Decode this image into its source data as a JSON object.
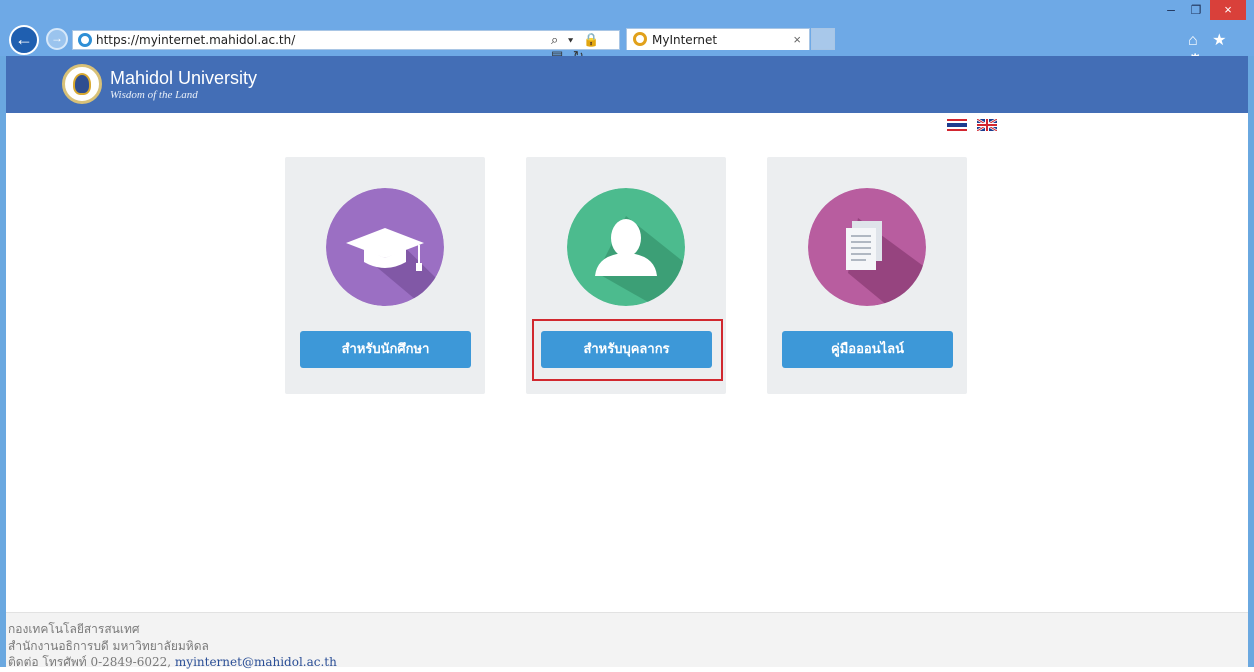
{
  "browser": {
    "url": "https://myinternet.mahidol.ac.th/",
    "tab_title": "MyInternet",
    "tab_close": "×",
    "window_min": "–",
    "window_restore": "❐",
    "window_close": "×",
    "address_tools": "⌕ ▾ 🔒 ▤ ↻",
    "toolbar_icons": "⌂ ★ ⚙"
  },
  "header": {
    "brand_name": "Mahidol University",
    "tagline": "Wisdom of the Land"
  },
  "languages": [
    "thai-flag-icon",
    "uk-flag-icon"
  ],
  "cards": [
    {
      "icon": "graduation-cap-icon",
      "label": "สำหรับนักศึกษา",
      "color": "#9b6fc3"
    },
    {
      "icon": "person-icon",
      "label": "สำหรับบุคลากร",
      "color": "#4cbb8e"
    },
    {
      "icon": "document-icon",
      "label": "คู่มือออนไลน์",
      "color": "#b85d9f"
    }
  ],
  "footer": {
    "line1": "กองเทคโนโลยีสารสนเทศ",
    "line2": "สำนักงานอธิการบดี มหาวิทยาลัยมหิดล",
    "line3_prefix": "ติดต่อ โทรศัพท์ 0-2849-6022, ",
    "email": "myinternet@mahidol.ac.th"
  },
  "colors": {
    "chrome": "#6ea9e6",
    "header": "#436eb6",
    "button": "#3d98d8",
    "highlight": "#d1282f"
  }
}
